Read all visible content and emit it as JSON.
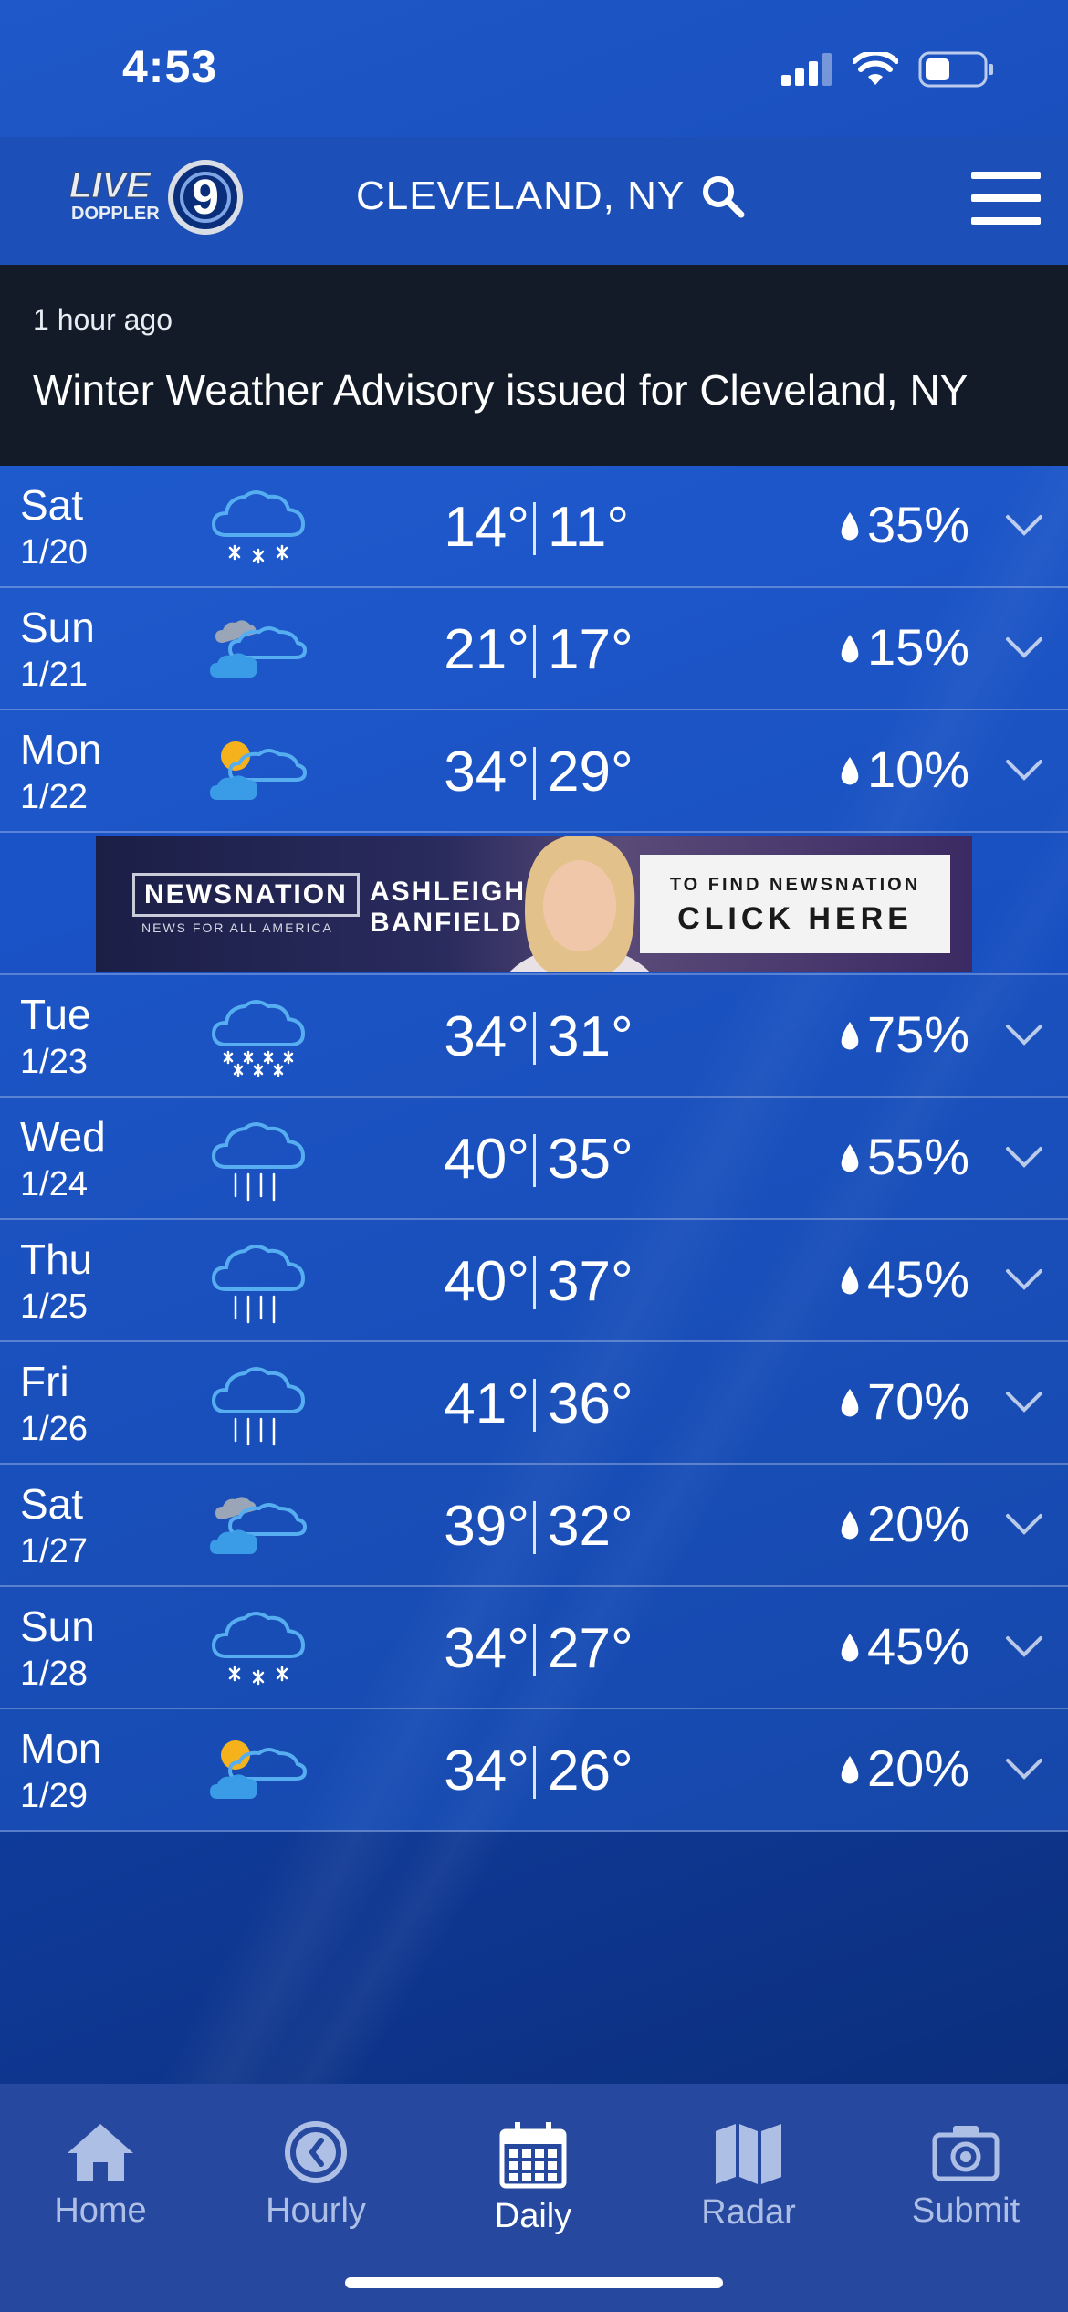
{
  "status_bar": {
    "time": "4:53"
  },
  "header": {
    "logo_text_main": "LIVE",
    "logo_text_sub": "DOPPLER",
    "logo_number": "9",
    "location": "CLEVELAND, NY"
  },
  "alert": {
    "time": "1 hour ago",
    "title": "Winter Weather Advisory issued for Cleveland, NY"
  },
  "forecast": {
    "days": [
      {
        "day": "Sat",
        "date": "1/20",
        "icon": "snow-icon",
        "high": "14°",
        "low": "11°",
        "precip": "35%"
      },
      {
        "day": "Sun",
        "date": "1/21",
        "icon": "cloudy-icon",
        "high": "21°",
        "low": "17°",
        "precip": "15%"
      },
      {
        "day": "Mon",
        "date": "1/22",
        "icon": "partly-cloudy-icon",
        "high": "34°",
        "low": "29°",
        "precip": "10%"
      },
      {
        "day": "Tue",
        "date": "1/23",
        "icon": "snow-icon",
        "high": "34°",
        "low": "31°",
        "precip": "75%"
      },
      {
        "day": "Wed",
        "date": "1/24",
        "icon": "rain-icon",
        "high": "40°",
        "low": "35°",
        "precip": "55%"
      },
      {
        "day": "Thu",
        "date": "1/25",
        "icon": "rain-icon",
        "high": "40°",
        "low": "37°",
        "precip": "45%"
      },
      {
        "day": "Fri",
        "date": "1/26",
        "icon": "rain-icon",
        "high": "41°",
        "low": "36°",
        "precip": "70%"
      },
      {
        "day": "Sat",
        "date": "1/27",
        "icon": "cloudy-icon",
        "high": "39°",
        "low": "32°",
        "precip": "20%"
      },
      {
        "day": "Sun",
        "date": "1/28",
        "icon": "snow-icon",
        "high": "34°",
        "low": "27°",
        "precip": "45%"
      },
      {
        "day": "Mon",
        "date": "1/29",
        "icon": "partly-cloudy-icon",
        "high": "34°",
        "low": "26°",
        "precip": "20%"
      }
    ]
  },
  "ad": {
    "brand": "NEWSNATION",
    "tagline": "NEWS FOR ALL AMERICA",
    "name_line1": "ASHLEIGH",
    "name_line2": "BANFIELD",
    "cta_line1": "TO FIND NEWSNATION",
    "cta_line2": "CLICK HERE"
  },
  "tab_bar": {
    "tabs": [
      {
        "label": "Home",
        "icon": "home-icon"
      },
      {
        "label": "Hourly",
        "icon": "clock-icon"
      },
      {
        "label": "Daily",
        "icon": "calendar-icon",
        "active": true
      },
      {
        "label": "Radar",
        "icon": "map-icon"
      },
      {
        "label": "Submit",
        "icon": "camera-icon"
      }
    ]
  },
  "colors": {
    "accent": "#1d4fb8",
    "alert_bg": "#121b27",
    "tab_bar_bg": "#26489e",
    "icon_cloud": "#4aa3e8",
    "icon_sun": "#f5b21c"
  }
}
